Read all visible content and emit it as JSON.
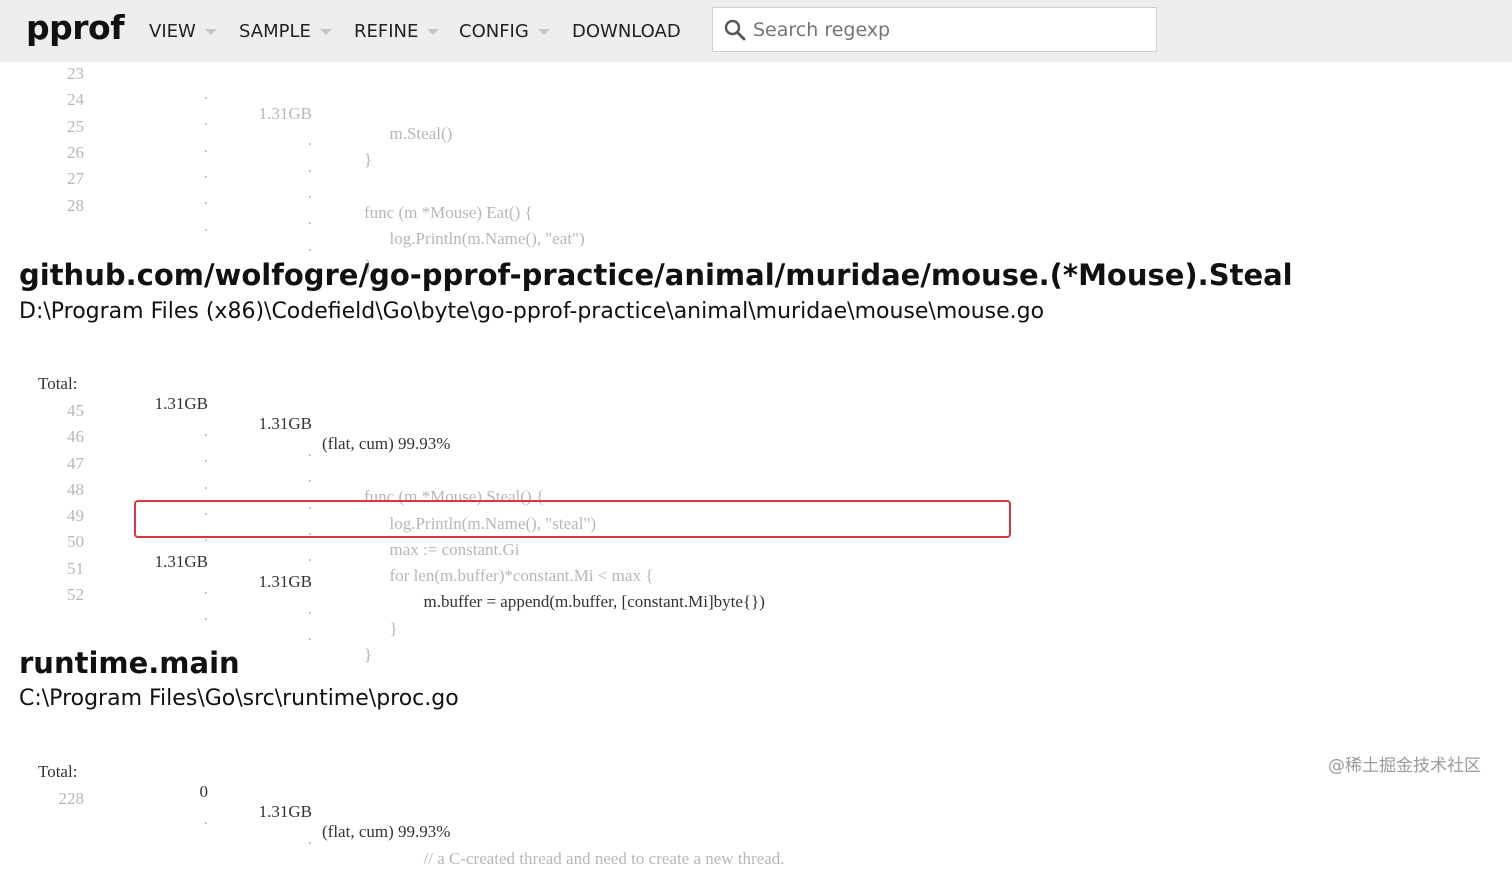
{
  "header": {
    "logo": "pprof",
    "menu": [
      {
        "label": "VIEW",
        "dropdown": true
      },
      {
        "label": "SAMPLE",
        "dropdown": true
      },
      {
        "label": "REFINE",
        "dropdown": true
      },
      {
        "label": "CONFIG",
        "dropdown": true
      },
      {
        "label": "DOWNLOAD",
        "dropdown": false
      }
    ],
    "search_placeholder": "Search regexp"
  },
  "block_top": {
    "lines": [
      {
        "line": "24",
        "flat": ".",
        "cum": ".",
        "src": "        }"
      },
      {
        "line": "25",
        "flat": ".",
        "cum": ".",
        "src": ""
      },
      {
        "line": "26",
        "flat": ".",
        "cum": ".",
        "src": "        func (m *Mouse) Eat() {"
      },
      {
        "line": "27",
        "flat": ".",
        "cum": ".",
        "src": "              log.Println(m.Name(), \"eat\")"
      },
      {
        "line": "28",
        "flat": ".",
        "cum": ".",
        "src": "        }"
      }
    ]
  },
  "section_steal": {
    "title": "github.com/wolfogre/go-pprof-practice/animal/muridae/mouse.(*Mouse).Steal",
    "path": "D:\\Program Files (x86)\\Codefield\\Go\\byte\\go-pprof-practice\\animal\\muridae\\mouse\\mouse.go",
    "total_label": "Total:",
    "total_flat": "1.31GB",
    "total_cum": "1.31GB",
    "total_note": "(flat, cum) 99.93%",
    "lines": [
      {
        "line": "45",
        "flat": ".",
        "cum": ".",
        "src": ""
      },
      {
        "line": "46",
        "flat": ".",
        "cum": ".",
        "src": "        func (m *Mouse) Steal() {"
      },
      {
        "line": "47",
        "flat": ".",
        "cum": ".",
        "src": "              log.Println(m.Name(), \"steal\")"
      },
      {
        "line": "48",
        "flat": ".",
        "cum": ".",
        "src": "              max := constant.Gi"
      },
      {
        "line": "49",
        "flat": ".",
        "cum": ".",
        "src": "              for len(m.buffer)*constant.Mi < max {"
      },
      {
        "line": "50",
        "flat": "1.31GB",
        "cum": "1.31GB",
        "src": "                      m.buffer = append(m.buffer, [constant.Mi]byte{})",
        "hot": true
      },
      {
        "line": "51",
        "flat": ".",
        "cum": ".",
        "src": "              }"
      },
      {
        "line": "52",
        "flat": ".",
        "cum": ".",
        "src": "        }"
      }
    ]
  },
  "section_main": {
    "title": "runtime.main",
    "path": "C:\\Program Files\\Go\\src\\runtime\\proc.go",
    "total_label": "Total:",
    "total_flat": "0",
    "total_cum": "1.31GB",
    "total_note": "(flat, cum) 99.93%",
    "lines": [
      {
        "line": "228",
        "flat": ".",
        "cum": ".",
        "src": "                      // a C-created thread and need to create a new thread."
      }
    ]
  },
  "watermark": "@稀土掘金技术社区",
  "colors": {
    "header_bg": "#eeeeee",
    "highlight_border": "#d9363e",
    "dim_code": "#b7b7b7"
  }
}
